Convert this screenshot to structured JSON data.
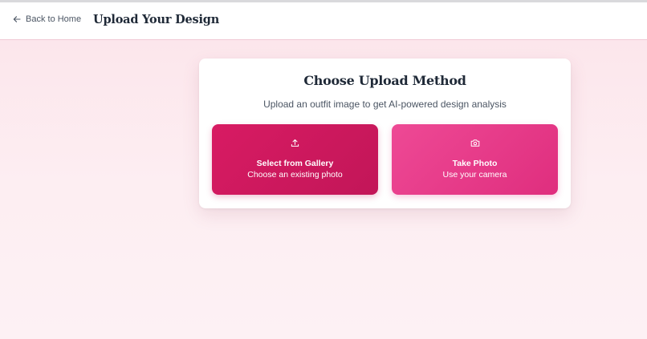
{
  "header": {
    "back_label": "Back to Home",
    "title": "Upload Your Design"
  },
  "card": {
    "title": "Choose Upload Method",
    "subtitle": "Upload an outfit image to get AI-powered design analysis",
    "gallery": {
      "label": "Select from Gallery",
      "sublabel": "Choose an existing photo",
      "icon": "upload-icon"
    },
    "camera": {
      "label": "Take Photo",
      "sublabel": "Use your camera",
      "icon": "camera-icon"
    }
  },
  "colors": {
    "gallery_button": "#d81b63",
    "camera_button": "#ee4995",
    "page_background": "#fce4ea"
  }
}
